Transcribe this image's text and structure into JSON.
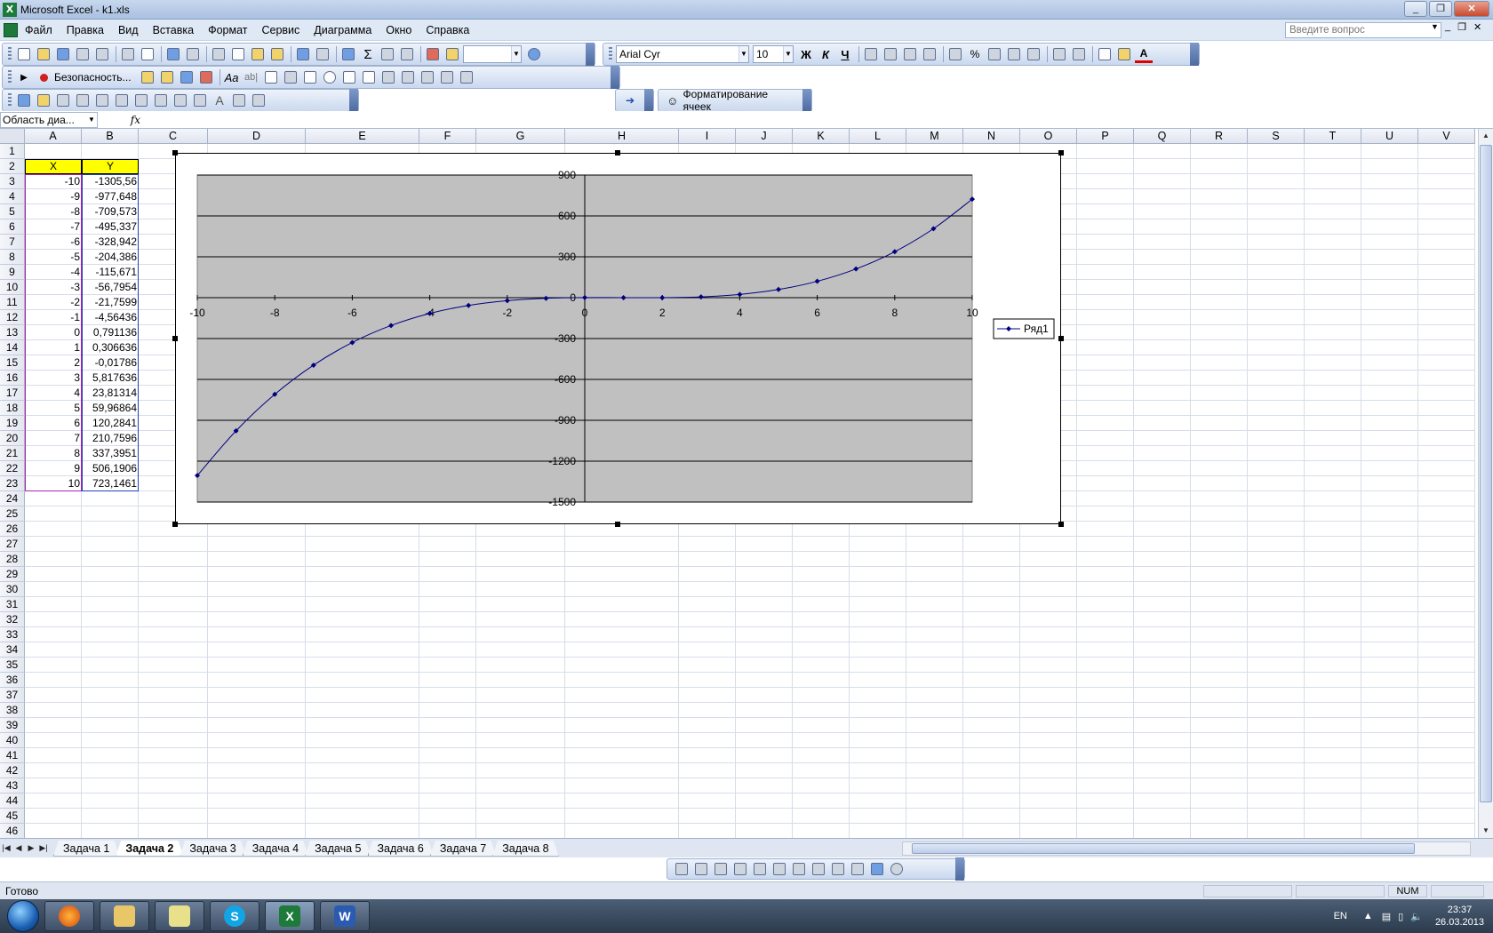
{
  "window": {
    "title": "Microsoft Excel - k1.xls",
    "app_icon": "excel-icon"
  },
  "menu": {
    "items": [
      "Файл",
      "Правка",
      "Вид",
      "Вставка",
      "Формат",
      "Сервис",
      "Диаграмма",
      "Окно",
      "Справка"
    ],
    "ask_placeholder": "Введите вопрос"
  },
  "toolbar1": {
    "font": "Arial Cyr",
    "size": "10",
    "bold": "Ж",
    "italic": "К",
    "underline": "Ч"
  },
  "toolbar2": {
    "security": "Безопасность..."
  },
  "toolbar3": {
    "format_cells": "Форматирование ячеек"
  },
  "namebox": {
    "value": "Область диа...",
    "fx": "fx"
  },
  "columns": [
    "A",
    "B",
    "C",
    "D",
    "E",
    "F",
    "G",
    "H",
    "I",
    "J",
    "K",
    "L",
    "M",
    "N",
    "O",
    "P",
    "Q",
    "R",
    "S",
    "T",
    "U",
    "V"
  ],
  "rows": [
    "1",
    "2",
    "3",
    "4",
    "5",
    "6",
    "7",
    "8",
    "9",
    "10",
    "11",
    "12",
    "13",
    "14",
    "15",
    "16",
    "17",
    "18",
    "19",
    "20",
    "21",
    "22",
    "23",
    "24",
    "25",
    "26",
    "27",
    "28",
    "29",
    "30",
    "31",
    "32",
    "33",
    "34",
    "35",
    "36",
    "37",
    "38",
    "39",
    "40",
    "41",
    "42",
    "43",
    "44",
    "45",
    "46"
  ],
  "table": {
    "header": {
      "x": "X",
      "y": "Y"
    },
    "x": [
      "-10",
      "-9",
      "-8",
      "-7",
      "-6",
      "-5",
      "-4",
      "-3",
      "-2",
      "-1",
      "0",
      "1",
      "2",
      "3",
      "4",
      "5",
      "6",
      "7",
      "8",
      "9",
      "10"
    ],
    "y": [
      "-1305,56",
      "-977,648",
      "-709,573",
      "-495,337",
      "-328,942",
      "-204,386",
      "-115,671",
      "-56,7954",
      "-21,7599",
      "-4,56436",
      "0,791136",
      "0,306636",
      "-0,01786",
      "5,817636",
      "23,81314",
      "59,96864",
      "120,2841",
      "210,7596",
      "337,3951",
      "506,1906",
      "723,1461"
    ]
  },
  "chart_data": {
    "type": "scatter",
    "series": [
      {
        "name": "Ряд1",
        "x": [
          -10,
          -9,
          -8,
          -7,
          -6,
          -5,
          -4,
          -3,
          -2,
          -1,
          0,
          1,
          2,
          3,
          4,
          5,
          6,
          7,
          8,
          9,
          10
        ],
        "y": [
          -1305.56,
          -977.648,
          -709.573,
          -495.337,
          -328.942,
          -204.386,
          -115.671,
          -56.7954,
          -21.7599,
          -4.56436,
          0.791136,
          0.306636,
          -0.01786,
          5.817636,
          23.81314,
          59.96864,
          120.2841,
          210.7596,
          337.3951,
          506.1906,
          723.1461
        ]
      }
    ],
    "xlim": [
      -10,
      10
    ],
    "ylim": [
      -1500,
      900
    ],
    "xticks": [
      "-10",
      "-8",
      "-6",
      "-4",
      "-2",
      "0",
      "2",
      "4",
      "6",
      "8",
      "10"
    ],
    "yticks": [
      "900",
      "600",
      "300",
      "0",
      "-300",
      "-600",
      "-900",
      "-1200",
      "-1500"
    ],
    "grid": true,
    "plot_background": "#c0c0c0",
    "line_color": "#000080",
    "legend_position": "right"
  },
  "sheets": [
    "Задача 1",
    "Задача 2",
    "Задача 3",
    "Задача 4",
    "Задача 5",
    "Задача 6",
    "Задача 7",
    "Задача 8"
  ],
  "active_sheet": "Задача 2",
  "status": {
    "text": "Готово",
    "num": "NUM"
  },
  "taskbar": {
    "lang": "EN",
    "time": "23:37",
    "date": "26.03.2013"
  }
}
